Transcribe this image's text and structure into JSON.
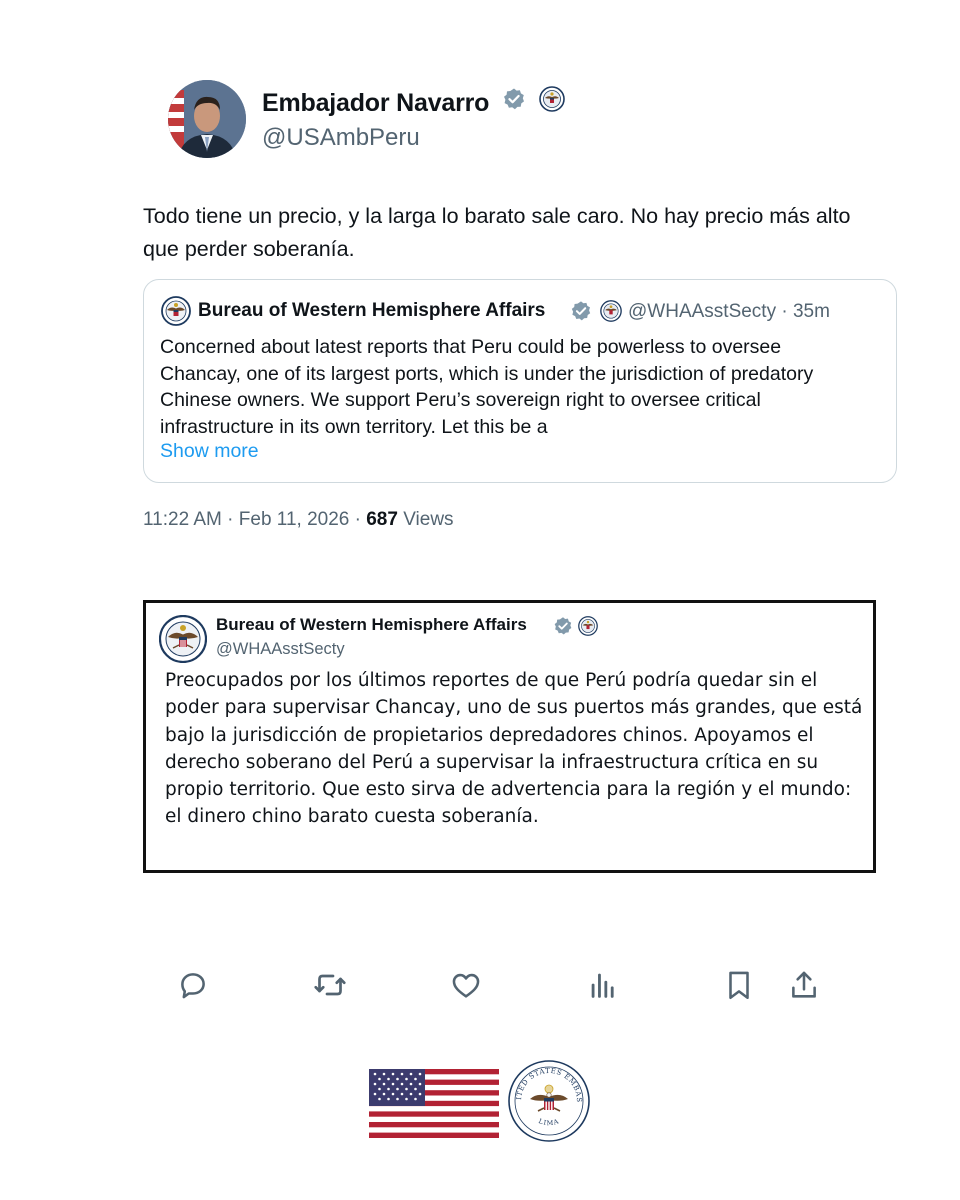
{
  "author": {
    "display_name": "Embajador Navarro",
    "handle": "@USAmbPeru",
    "badges": [
      "verified-badge-icon",
      "state-department-seal-icon"
    ]
  },
  "tweet": {
    "text": "Todo tiene un precio, y la larga lo barato sale caro. No hay precio más alto que perder soberanía."
  },
  "quoted": {
    "display_name": "Bureau of Western Hemisphere Affairs",
    "handle": "@WHAAsstSecty",
    "separator": "·",
    "age": "35m",
    "text": "Concerned about latest reports that Peru could be powerless to oversee\nChancay, one of its largest ports, which is under the jurisdiction of predatory\nChinese owners.  We support Peru’s sovereign right to oversee critical\ninfrastructure in its own territory.  Let this be a",
    "show_more": "Show more"
  },
  "meta": {
    "time": "11:22 AM",
    "separator": "·",
    "date": "Feb 11, 2026",
    "views_count": "687",
    "views_label": "Views"
  },
  "translation": {
    "display_name": "Bureau of Western Hemisphere Affairs",
    "handle": "@WHAAsstSecty",
    "text": "Preocupados por los últimos reportes de que Perú podría quedar sin el poder para supervisar Chancay, uno de sus puertos más grandes, que está bajo la jurisdicción de propietarios depredadores chinos. Apoyamos el derecho soberano del Perú a supervisar la infraestructura crítica en su propio territorio. Que esto sirva de advertencia para la región y el mundo: el dinero chino barato cuesta soberanía."
  },
  "actions": [
    "reply-icon",
    "repost-icon",
    "like-icon",
    "views-icon",
    "bookmark-icon",
    "share-icon"
  ],
  "footer": {
    "seal_text_top": "UNITED STATES EMBASSY",
    "seal_text_bottom": "LIMA"
  },
  "colors": {
    "text": "#0f1419",
    "secondary": "#536471",
    "link": "#1d9bf0",
    "border": "#cfd9de",
    "verified": "#829aab"
  }
}
